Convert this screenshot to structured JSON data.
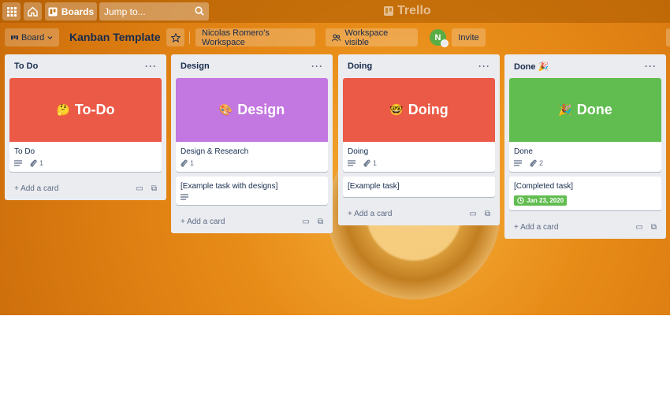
{
  "topbar": {
    "apps_icon": "grid-icon",
    "home_icon": "home-icon",
    "boards_label": "Boards",
    "search_placeholder": "Jump to...",
    "app_name": "Trello"
  },
  "board_header": {
    "view_label": "Board",
    "title": "Kanban Template",
    "workspace_label": "Nicolas Romero's Workspace",
    "visibility_label": "Workspace visible",
    "avatar_initial": "N",
    "invite_label": "Invite"
  },
  "lists": [
    {
      "title": "To Do",
      "title_emoji": "",
      "cards": [
        {
          "cover_color": "#eb5a46",
          "cover_emoji": "🤔",
          "cover_text": "To-Do",
          "title": "To Do",
          "description_icon": true,
          "attachments": "1"
        }
      ],
      "add_label": "Add a card"
    },
    {
      "title": "Design",
      "title_emoji": "",
      "cards": [
        {
          "cover_color": "#c377e0",
          "cover_emoji": "🎨",
          "cover_text": "Design",
          "title": "Design & Research",
          "description_icon": false,
          "attachments": "1"
        },
        {
          "title": "[Example task with designs]",
          "description_icon": true
        }
      ],
      "add_label": "Add a card"
    },
    {
      "title": "Doing",
      "title_emoji": "",
      "cards": [
        {
          "cover_color": "#eb5a46",
          "cover_emoji": "🤓",
          "cover_text": "Doing",
          "title": "Doing",
          "description_icon": true,
          "attachments": "1"
        },
        {
          "title": "[Example task]"
        }
      ],
      "add_label": "Add a card"
    },
    {
      "title": "Done",
      "title_emoji": "🎉",
      "cards": [
        {
          "cover_color": "#61bd4f",
          "cover_emoji": "🎉",
          "cover_text": "Done",
          "title": "Done",
          "description_icon": true,
          "attachments": "2"
        },
        {
          "title": "[Completed task]",
          "due_date": "Jan 23, 2020"
        }
      ],
      "add_label": "Add a card"
    }
  ]
}
